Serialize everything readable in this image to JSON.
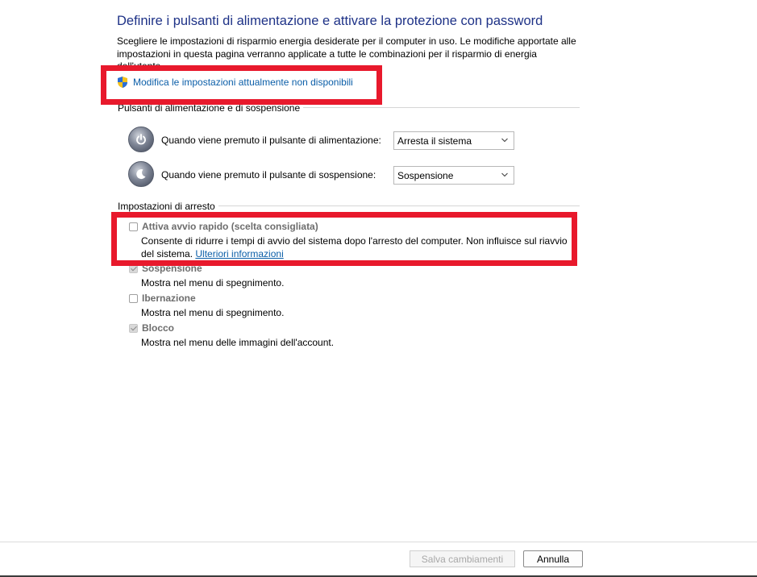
{
  "header": {
    "title": "Definire i pulsanti di alimentazione e attivare la protezione con password",
    "description": "Scegliere le impostazioni di risparmio energia desiderate per il computer in uso. Le modifiche apportate alle impostazioni in questa pagina verranno applicate a tutte le combinazioni per il risparmio di energia",
    "description_cut": "dell'utente"
  },
  "admin_link": {
    "label": "Modifica le impostazioni attualmente non disponibili",
    "icon": "uac-shield-icon"
  },
  "power_section": {
    "heading": "Pulsanti di alimentazione e di sospensione",
    "rows": [
      {
        "label": "Quando viene premuto il pulsante di alimentazione:",
        "value": "Arresta il sistema",
        "icon": "power-button-icon"
      },
      {
        "label": "Quando viene premuto il pulsante di sospensione:",
        "value": "Sospensione",
        "icon": "sleep-button-icon"
      }
    ]
  },
  "shutdown_section": {
    "heading": "Impostazioni di arresto",
    "items": [
      {
        "title": "Attiva avvio rapido (scelta consigliata)",
        "desc_line1": "Consente di ridurre i tempi di avvio del sistema dopo l'arresto del computer. Non influisce sul riavvio",
        "desc_line2": "del sistema.",
        "link": "Ulteriori informazioni",
        "checked": false
      },
      {
        "title": "Sospensione",
        "desc_line1": "Mostra nel menu di spegnimento.",
        "checked": true
      },
      {
        "title": "Ibernazione",
        "desc_line1": "Mostra nel menu di spegnimento.",
        "checked": false
      },
      {
        "title": "Blocco",
        "desc_line1": "Mostra nel menu delle immagini dell'account.",
        "checked": true
      }
    ]
  },
  "footer": {
    "save_label": "Salva cambiamenti",
    "cancel_label": "Annulla"
  },
  "colors": {
    "title": "#1e3287",
    "link": "#0b5ea8",
    "highlight": "#e8192c"
  }
}
